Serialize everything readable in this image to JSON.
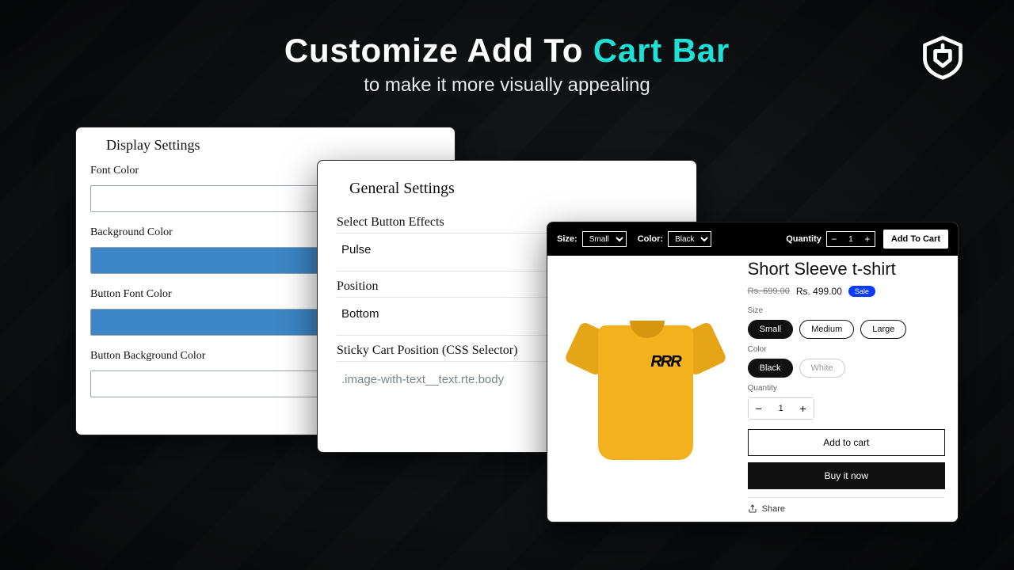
{
  "hero": {
    "title_pre": "Customize Add To ",
    "title_accent": "Cart Bar",
    "subtitle": "to make it more visually appealing"
  },
  "display_settings": {
    "heading": "Display Settings",
    "font_color_label": "Font Color",
    "background_color_label": "Background Color",
    "button_font_color_label": "Button Font Color",
    "button_background_color_label": "Button Background Color",
    "swatch_white": "#ffffff",
    "swatch_blue": "#3c87c7"
  },
  "general_settings": {
    "heading": "General Settings",
    "effects_label": "Select Button Effects",
    "effects_value": "Pulse",
    "position_label": "Position",
    "position_value": "Bottom",
    "css_label": "Sticky Cart Position (CSS Selector)",
    "css_value": ".image-with-text__text.rte.body"
  },
  "cartbar": {
    "size_label": "Size:",
    "size_value": "Small",
    "color_label": "Color:",
    "color_value": "Black",
    "quantity_label": "Quantity",
    "quantity_value": "1",
    "add_label": "Add To Cart"
  },
  "product": {
    "title": "Short Sleeve t-shirt",
    "price_old": "Rs. 699.00",
    "price_new": "Rs. 499.00",
    "sale_badge": "Sale",
    "size_label": "Size",
    "sizes": {
      "0": "Small",
      "1": "Medium",
      "2": "Large"
    },
    "color_label": "Color",
    "colors": {
      "0": "Black",
      "1": "White"
    },
    "quantity_label": "Quantity",
    "quantity_value": "1",
    "add_to_cart": "Add to cart",
    "buy_now": "Buy it now",
    "share": "Share",
    "imprint": "RRR"
  }
}
